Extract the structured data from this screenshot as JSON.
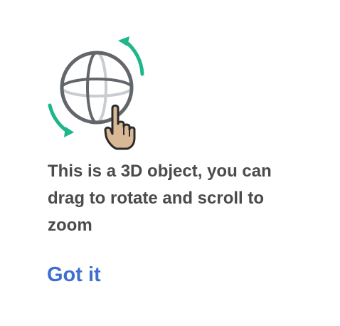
{
  "dialog": {
    "illustration_icon": "rotate-3d-object-icon",
    "message": "This is a 3D object, you can drag to rotate and scroll to zoom",
    "got_it_label": "Got it"
  },
  "colors": {
    "arrow_accent": "#1fb68a",
    "globe_stroke": "#63666a",
    "globe_inner": "#c9ccd0",
    "hand_fill": "#d9b895",
    "hand_stroke": "#2b2b2b",
    "message_text": "#4a4b4d",
    "link_text": "#3d6fd1"
  }
}
